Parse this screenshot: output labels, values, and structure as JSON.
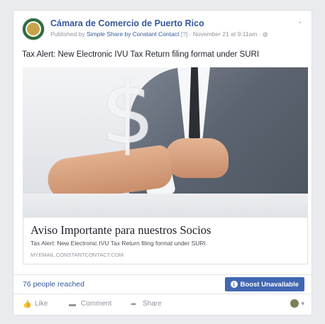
{
  "post": {
    "page_name": "Cámara de Comercio de Puerto Rico",
    "meta_published_by": "Published by",
    "meta_app": "Simple Share by Constant Contact",
    "meta_marker": "[?]",
    "meta_date": "November 21 at 9:11am",
    "text": "Tax Alert: New Electronic IVU Tax Return filing format under SURI"
  },
  "link_preview": {
    "title": "Aviso Importante para nuestros Socios",
    "description": "Tax Alert: New Electronic IVU Tax Return filing format under SURI",
    "domain": "myemail.constantcontact.com"
  },
  "stats": {
    "reached": "76 people reached",
    "boost_label": "Boost Unavailable"
  },
  "actions": {
    "like": "Like",
    "comment": "Comment",
    "share": "Share"
  },
  "icons": {
    "avatar": "chamber-logo-icon",
    "globe": "globe-icon",
    "chevron": "chevron-down-icon",
    "boost_info": "info-icon"
  },
  "colors": {
    "link": "#365899",
    "boost_bg": "#4267b2",
    "muted": "#90949c"
  }
}
